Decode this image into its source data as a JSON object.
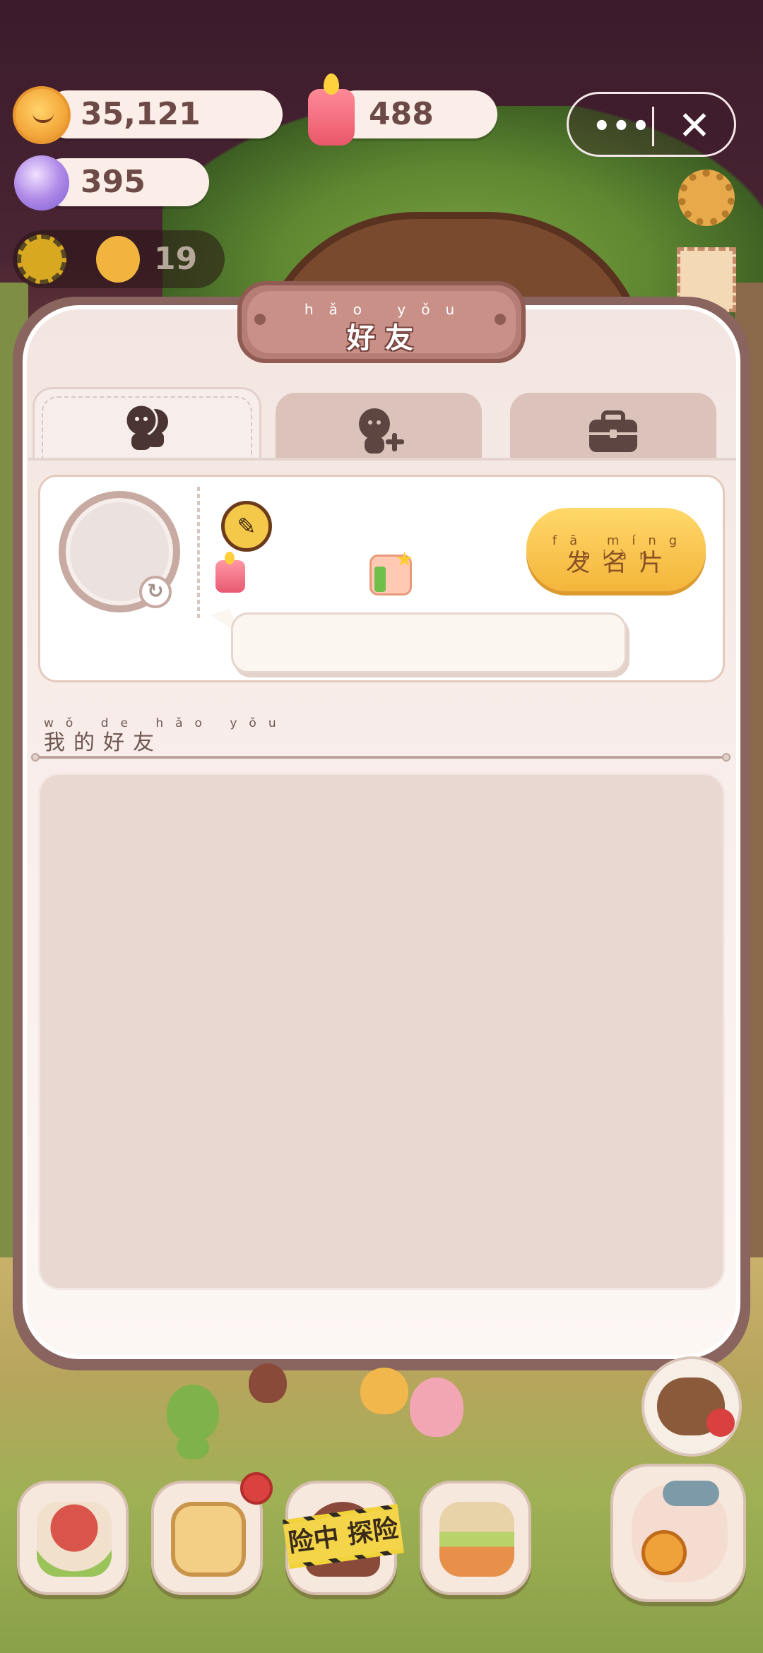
{
  "hud": {
    "coins": "35,121",
    "candles": "488",
    "candies": "395",
    "sun_count": "19"
  },
  "top_buttons": {
    "more": "•••",
    "close": "✕"
  },
  "dialog": {
    "title_pinyin": "hǎo yǒu",
    "title": "好友",
    "tabs": [
      {
        "icon": "friends-icon",
        "active": true
      },
      {
        "icon": "add-friend-icon",
        "active": false
      },
      {
        "icon": "briefcase-icon",
        "active": false
      }
    ],
    "card": {
      "send_card_pinyin": "fā míng piàn",
      "send_card_label": "发名片",
      "refresh_glyph": "↻",
      "edit_glyph": "✎"
    },
    "friends_section": {
      "pinyin": "wǒ de hǎo yǒu",
      "title": "我的好友"
    }
  },
  "bottom_nav": {
    "adventure_label": "险中 探险",
    "items": [
      {
        "icon": "mushroom-house-icon"
      },
      {
        "icon": "notebook-icon"
      },
      {
        "icon": "adventure-icon"
      },
      {
        "icon": "shop-icon"
      },
      {
        "icon": "fish-alarm-icon"
      }
    ]
  },
  "colors": {
    "panel": "#f7eeec",
    "accent_button": "#f4b53b",
    "plaque": "#b57d74"
  }
}
